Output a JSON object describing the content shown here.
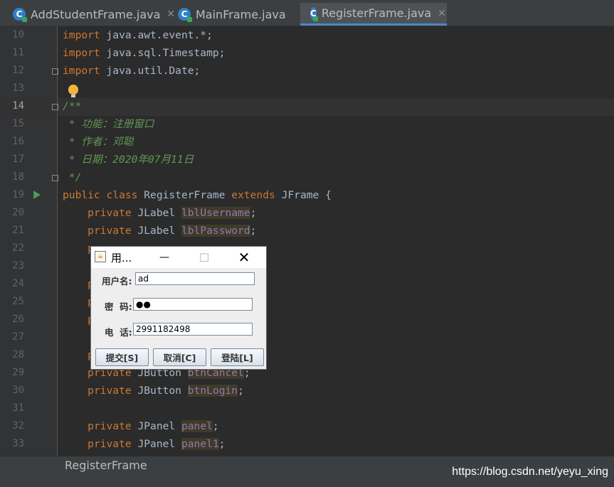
{
  "tabs": [
    {
      "label": "AddStudentFrame.java",
      "icon": "java-class-icon",
      "active": false
    },
    {
      "label": "MainFrame.java",
      "icon": "java-class-icon",
      "active": false
    },
    {
      "label": "RegisterFrame.java",
      "icon": "java-class-icon",
      "active": true
    }
  ],
  "editor": {
    "line_numbers": [
      "10",
      "11",
      "12",
      "13",
      "14",
      "15",
      "16",
      "17",
      "18",
      "19",
      "20",
      "21",
      "22",
      "23",
      "24",
      "25",
      "26",
      "27",
      "28",
      "29",
      "30",
      "31",
      "32",
      "33"
    ],
    "current_line": "14",
    "imports": [
      "java.awt.event.*",
      "java.sql.Timestamp",
      "java.util.Date"
    ],
    "doc_comment": {
      "open": "/**",
      "line1": " * 功能：注册窗口",
      "line2": " * 作者：邓聪",
      "line3": " * 日期：2020年07月11日",
      "close": " */"
    },
    "class_decl": {
      "kw1": "public",
      "kw2": "class",
      "name": "RegisterFrame",
      "kw3": "extends",
      "parent": "JFrame",
      "brace": "{"
    },
    "fields": [
      {
        "kw": "private",
        "type": "JLabel",
        "name": "lblUsername"
      },
      {
        "kw": "private",
        "type": "JLabel",
        "name": "lblPassword"
      },
      {
        "kw": "p",
        "type": "",
        "name": ""
      },
      {
        "kw": "p",
        "type": "",
        "name": "me"
      },
      {
        "kw": "p",
        "type": "",
        "name": "one"
      },
      {
        "kw": "p",
        "type": "",
        "name": "ssword"
      },
      {
        "kw": "p",
        "type": "",
        "name": ""
      },
      {
        "kw": "private",
        "type": "JButton",
        "name": "btnCancel"
      },
      {
        "kw": "private",
        "type": "JButton",
        "name": "btnLogin"
      },
      {
        "kw": "private",
        "type": "JPanel",
        "name": "panel"
      },
      {
        "kw": "private",
        "type": "JPanel",
        "name": "panel1"
      }
    ]
  },
  "dialog": {
    "title": "用...",
    "min_glyph": "—",
    "max_glyph": "☐",
    "close_glyph": "✕",
    "java_icon_glyph": "☕",
    "username_label": "用户名:",
    "username_value": "ad",
    "password_label": "密  码:",
    "password_value": "●●",
    "phone_label": "电  话:",
    "phone_value": "2991182498",
    "submit_label": "提交[S]",
    "cancel_label": "取消[C]",
    "login_label": "登陆[L]"
  },
  "status": {
    "class_name": "RegisterFrame"
  },
  "watermark": "https://blog.csdn.net/yeyu_xing",
  "colors": {
    "editor_bg": "#2b2b2b",
    "keyword": "#cc7832",
    "doc_comment": "#629755",
    "field": "#9876aa",
    "accent": "#4a88c7"
  }
}
